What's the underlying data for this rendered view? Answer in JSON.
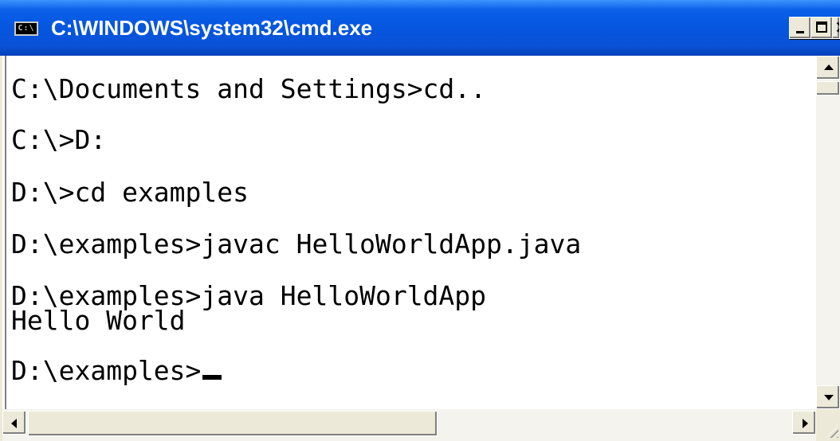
{
  "window": {
    "title": "C:\\WINDOWS\\system32\\cmd.exe",
    "icon": "cmd-icon",
    "icon_label": "C:\\",
    "buttons": {
      "minimize": "minimize-icon",
      "maximize": "maximize-icon",
      "close": "close-icon"
    }
  },
  "console": {
    "lines": [
      "C:\\Documents and Settings>cd..",
      "C:\\>D:",
      "D:\\>cd examples",
      "D:\\examples>javac HelloWorldApp.java",
      "D:\\examples>java HelloWorldApp",
      "Hello World",
      "D:\\examples>"
    ],
    "foreground": "#000000",
    "background": "#ffffff"
  },
  "colors": {
    "titlebar": "#0555de",
    "title_text": "#ffffff",
    "chrome": "#ece9d8"
  }
}
